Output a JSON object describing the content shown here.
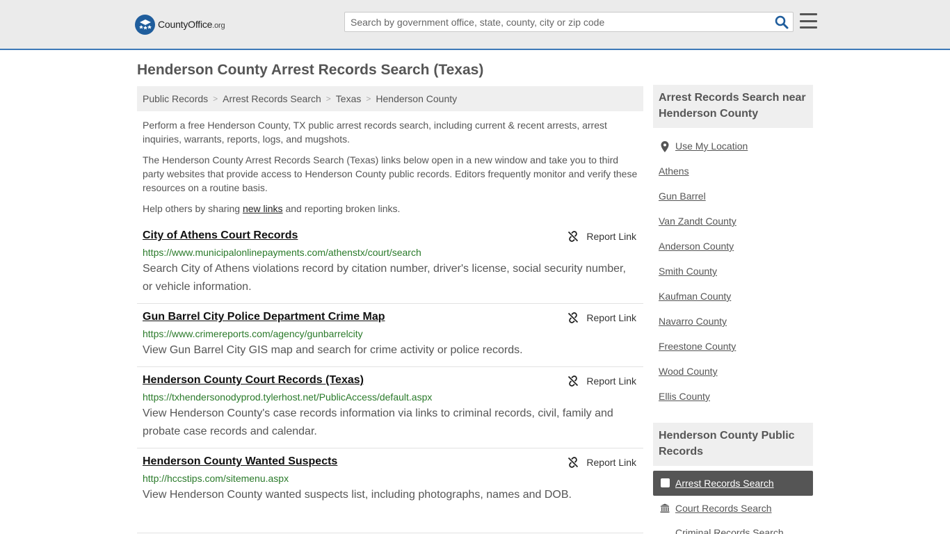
{
  "header": {
    "logo_main": "CountyOffice",
    "logo_tld": ".org",
    "search_placeholder": "Search by government office, state, county, city or zip code"
  },
  "page": {
    "title": "Henderson County Arrest Records Search (Texas)"
  },
  "breadcrumb": [
    "Public Records",
    "Arrest Records Search",
    "Texas",
    "Henderson County"
  ],
  "intro": {
    "p1": "Perform a free Henderson County, TX public arrest records search, including current & recent arrests, arrest inquiries, warrants, reports, logs, and mugshots.",
    "p2": "The Henderson County Arrest Records Search (Texas) links below open in a new window and take you to third party websites that provide access to Henderson County public records. Editors frequently monitor and verify these resources on a routine basis.",
    "p3_before": "Help others by sharing ",
    "p3_link": "new links",
    "p3_after": " and reporting broken links."
  },
  "report_label": "Report Link",
  "results": [
    {
      "title": "City of Athens Court Records",
      "url": "https://www.municipalonlinepayments.com/athenstx/court/search",
      "desc": "Search City of Athens violations record by citation number, driver's license, social security number, or vehicle information."
    },
    {
      "title": "Gun Barrel City Police Department Crime Map",
      "url": "https://www.crimereports.com/agency/gunbarrelcity",
      "desc": "View Gun Barrel City GIS map and search for crime activity or police records."
    },
    {
      "title": "Henderson County Court Records (Texas)",
      "url": "https://txhendersonodyprod.tylerhost.net/PublicAccess/default.aspx",
      "desc": "View Henderson County's case records information via links to criminal records, civil, family and probate case records and calendar."
    },
    {
      "title": "Henderson County Wanted Suspects",
      "url": "http://hccstips.com/sitemenu.aspx",
      "desc": "View Henderson County wanted suspects list, including photographs, names and DOB."
    }
  ],
  "sidebar": {
    "nearby_heading": "Arrest Records Search near Henderson County",
    "use_location": "Use My Location",
    "nearby": [
      "Athens",
      "Gun Barrel",
      "Van Zandt County",
      "Anderson County",
      "Smith County",
      "Kaufman County",
      "Navarro County",
      "Freestone County",
      "Wood County",
      "Ellis County"
    ],
    "public_heading": "Henderson County Public Records",
    "public_active": "Arrest Records Search",
    "public_links": [
      "Court Records Search",
      "Criminal Records Search"
    ]
  }
}
